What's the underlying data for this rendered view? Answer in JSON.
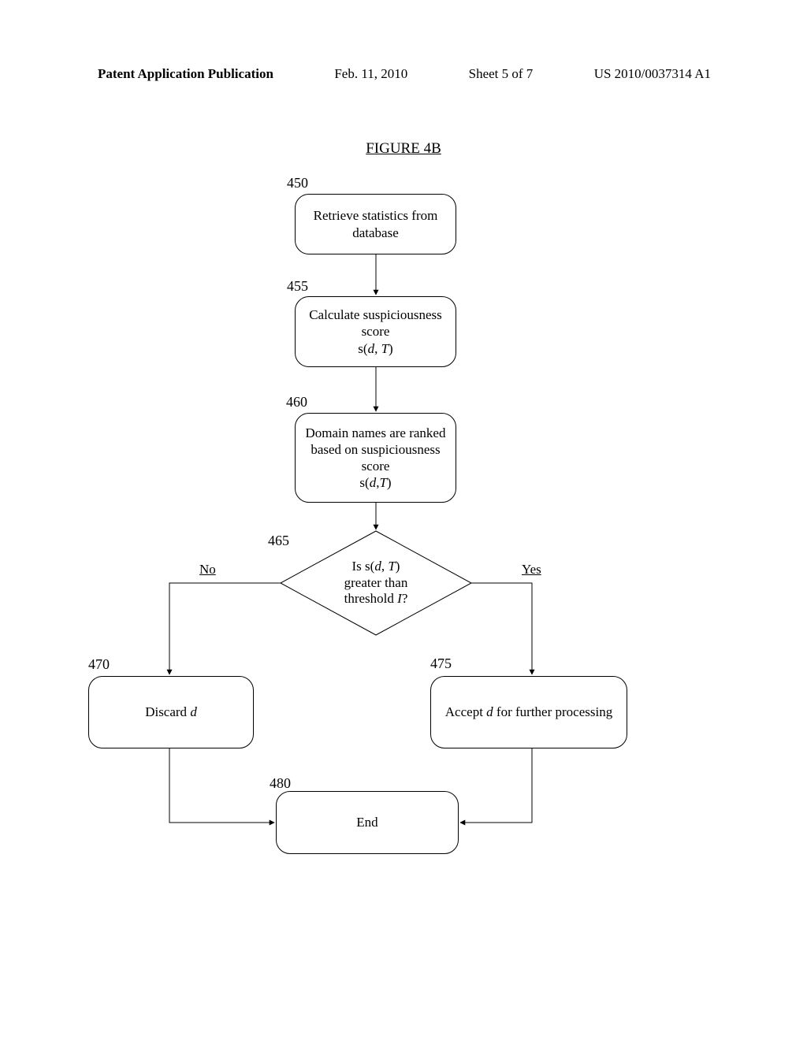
{
  "header": {
    "left": "Patent Application Publication",
    "date": "Feb. 11, 2010",
    "sheet": "Sheet 5 of 7",
    "pubno": "US 2010/0037314 A1"
  },
  "figure_title": "FIGURE 4B",
  "refs": {
    "r450": "450",
    "r455": "455",
    "r460": "460",
    "r465": "465",
    "r470": "470",
    "r475": "475",
    "r480": "480"
  },
  "nodes": {
    "n450": "Retrieve statistics from database",
    "n455_a": "Calculate suspiciousness score",
    "n455_b": "s(d, T)",
    "n460_a": "Domain names are ranked based on suspiciousness score",
    "n460_b": "s(d,T)",
    "n465_a": "Is s(d, T)",
    "n465_b": "greater than",
    "n465_c": "threshold I?",
    "n470_a": "Discard ",
    "n470_b": "d",
    "n475_a": "Accept ",
    "n475_b": "d",
    "n475_c": " for further processing",
    "n480": "End"
  },
  "edges": {
    "no": "No",
    "yes": "Yes"
  },
  "chart_data": {
    "type": "flowchart",
    "title": "FIGURE 4B",
    "nodes": [
      {
        "id": "450",
        "type": "process",
        "label": "Retrieve statistics from database"
      },
      {
        "id": "455",
        "type": "process",
        "label": "Calculate suspiciousness score s(d, T)"
      },
      {
        "id": "460",
        "type": "process",
        "label": "Domain names are ranked based on suspiciousness score s(d,T)"
      },
      {
        "id": "465",
        "type": "decision",
        "label": "Is s(d, T) greater than threshold I?"
      },
      {
        "id": "470",
        "type": "process",
        "label": "Discard d"
      },
      {
        "id": "475",
        "type": "process",
        "label": "Accept d for further processing"
      },
      {
        "id": "480",
        "type": "terminator",
        "label": "End"
      }
    ],
    "edges": [
      {
        "from": "450",
        "to": "455",
        "label": ""
      },
      {
        "from": "455",
        "to": "460",
        "label": ""
      },
      {
        "from": "460",
        "to": "465",
        "label": ""
      },
      {
        "from": "465",
        "to": "470",
        "label": "No"
      },
      {
        "from": "465",
        "to": "475",
        "label": "Yes"
      },
      {
        "from": "470",
        "to": "480",
        "label": ""
      },
      {
        "from": "475",
        "to": "480",
        "label": ""
      }
    ]
  }
}
